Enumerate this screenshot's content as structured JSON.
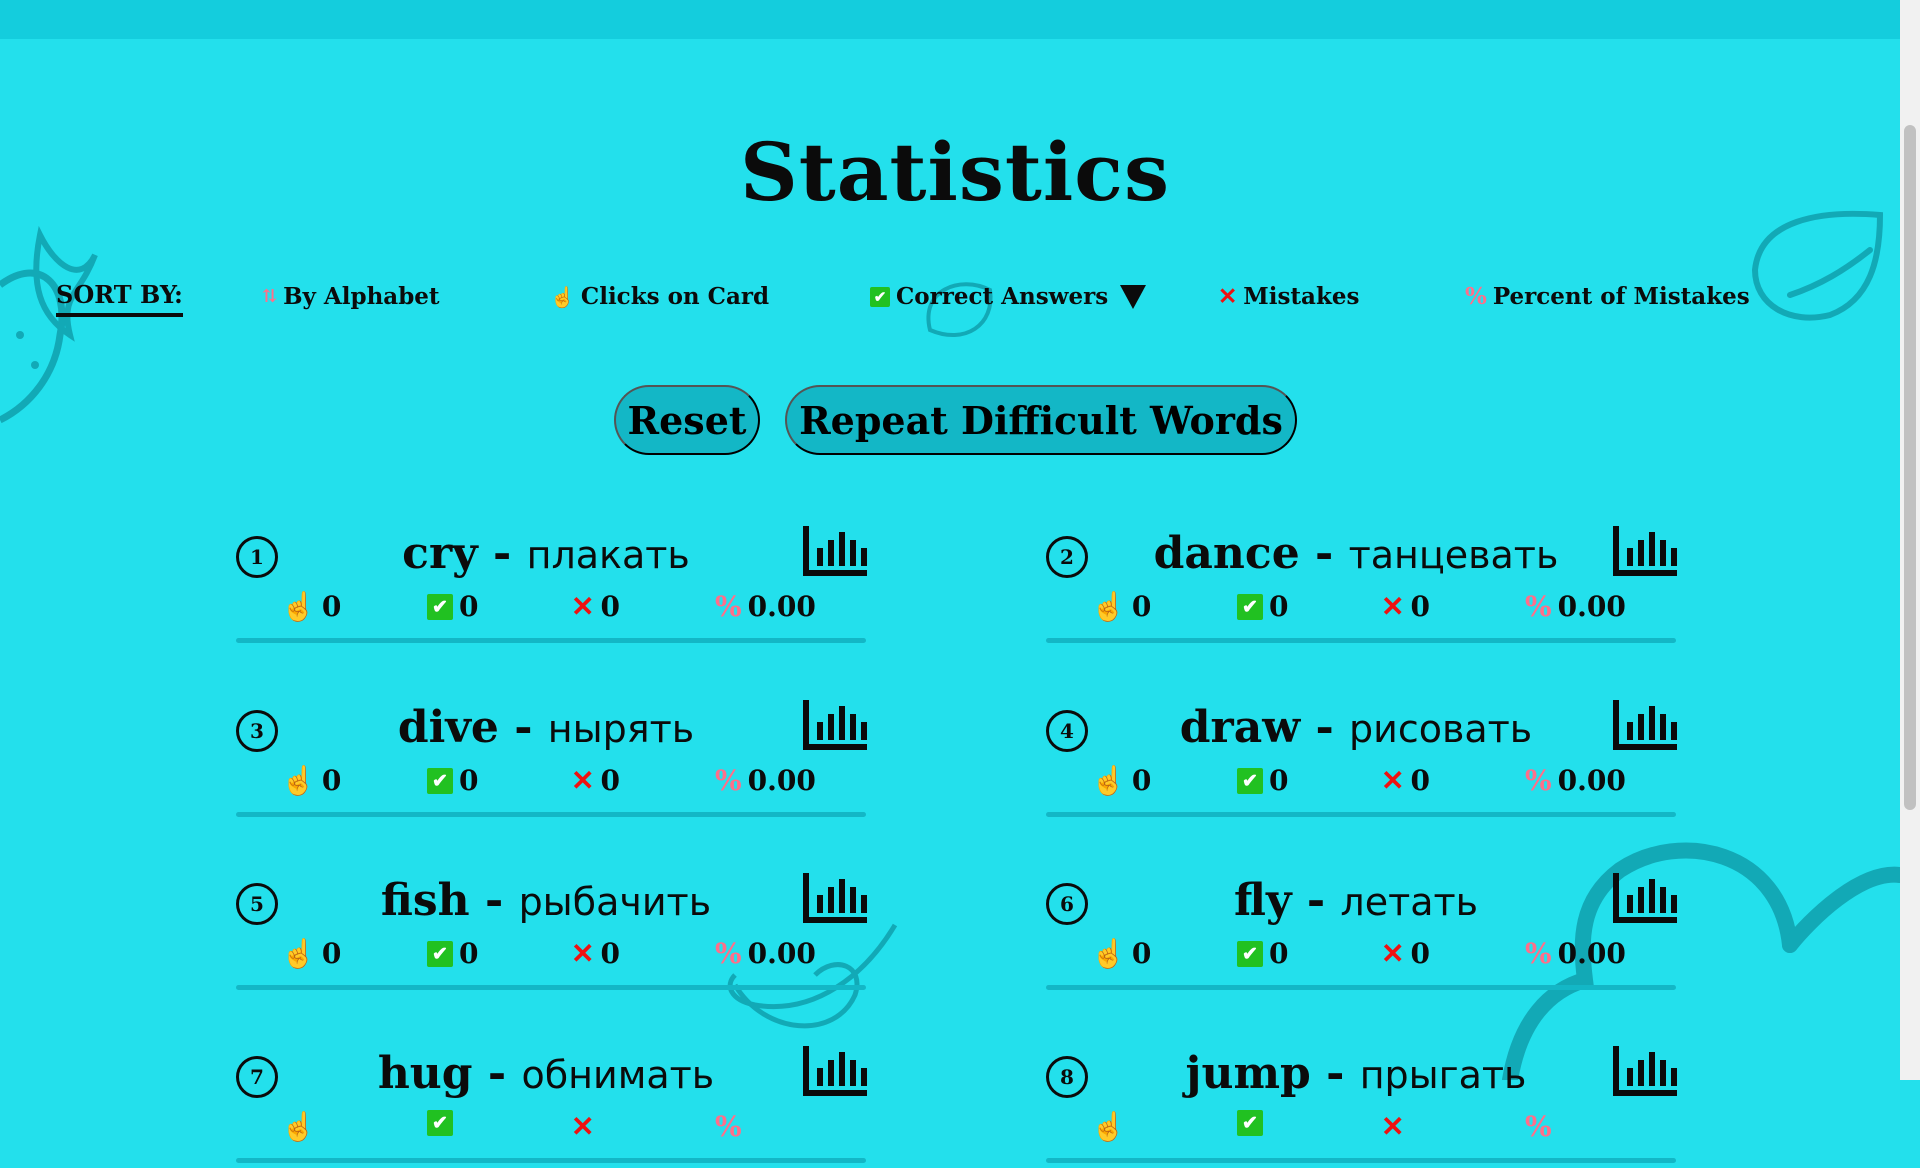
{
  "page": {
    "title": "Statistics"
  },
  "sort": {
    "label": "SORT BY:",
    "options": [
      {
        "label": "By Alphabet",
        "icon": "sort-alpha-icon"
      },
      {
        "label": "Clicks on Card",
        "icon": "hand-pointer-icon"
      },
      {
        "label": "Correct Answers",
        "icon": "check-icon",
        "active": true
      },
      {
        "label": "Mistakes",
        "icon": "x-icon"
      },
      {
        "label": "Percent of Mistakes",
        "icon": "percent-icon"
      }
    ]
  },
  "buttons": {
    "reset": "Reset",
    "repeat": "Repeat Difficult Words"
  },
  "words": [
    {
      "num": "1",
      "en": "cry",
      "ru": "плакать",
      "clicks": "0",
      "correct": "0",
      "mistakes": "0",
      "percent": "0.00"
    },
    {
      "num": "2",
      "en": "dance",
      "ru": "танцевать",
      "clicks": "0",
      "correct": "0",
      "mistakes": "0",
      "percent": "0.00"
    },
    {
      "num": "3",
      "en": "dive",
      "ru": "нырять",
      "clicks": "0",
      "correct": "0",
      "mistakes": "0",
      "percent": "0.00"
    },
    {
      "num": "4",
      "en": "draw",
      "ru": "рисовать",
      "clicks": "0",
      "correct": "0",
      "mistakes": "0",
      "percent": "0.00"
    },
    {
      "num": "5",
      "en": "fish",
      "ru": "рыбачить",
      "clicks": "0",
      "correct": "0",
      "mistakes": "0",
      "percent": "0.00"
    },
    {
      "num": "6",
      "en": "fly",
      "ru": "летать",
      "clicks": "0",
      "correct": "0",
      "mistakes": "0",
      "percent": "0.00"
    },
    {
      "num": "7",
      "en": "hug",
      "ru": "обнимать",
      "clicks": "",
      "correct": "",
      "mistakes": "",
      "percent": ""
    },
    {
      "num": "8",
      "en": "jump",
      "ru": "прыгать",
      "clicks": "",
      "correct": "",
      "mistakes": "",
      "percent": ""
    }
  ],
  "sep": " - ",
  "colors": {
    "background": "#23e0ec",
    "accent": "#13b7c6",
    "correct": "#21c121",
    "mistake": "#ee1111",
    "percent": "#ff6f8a"
  }
}
